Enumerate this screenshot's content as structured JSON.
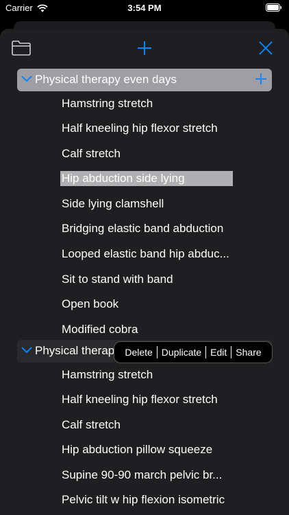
{
  "status_bar": {
    "carrier": "Carrier",
    "time": "3:54 PM"
  },
  "colors": {
    "accent": "#0a84ff",
    "sheet": "#1f1f21",
    "selected_row": "#9e9ea3"
  },
  "toolbar": {
    "left_icon": "folder-icon",
    "center_icon": "plus-icon",
    "right_icon": "close-icon"
  },
  "sections": [
    {
      "title": "Physical therapy even days",
      "expanded": true,
      "selected": true,
      "items": [
        "Hamstring stretch",
        "Half kneeling hip flexor stretch",
        "Calf stretch",
        "Hip abduction side lying",
        "Side lying clamshell",
        "Bridging elastic band abduction",
        "Looped elastic band hip abduc...",
        "Sit to stand with band",
        "Open book",
        "Modified cobra"
      ],
      "highlighted_item": "Hip abduction side lying"
    },
    {
      "title": "Physical therap",
      "expanded": true,
      "selected": false,
      "items": [
        "Hamstring stretch",
        "Half kneeling hip flexor stretch",
        "Calf stretch",
        "Hip abduction pillow squeeze",
        "Supine 90-90 march pelvic br...",
        "Pelvic tilt w hip flexion isometric"
      ]
    }
  ],
  "context_menu": {
    "items": [
      "Delete",
      "Duplicate",
      "Edit",
      "Share"
    ]
  }
}
